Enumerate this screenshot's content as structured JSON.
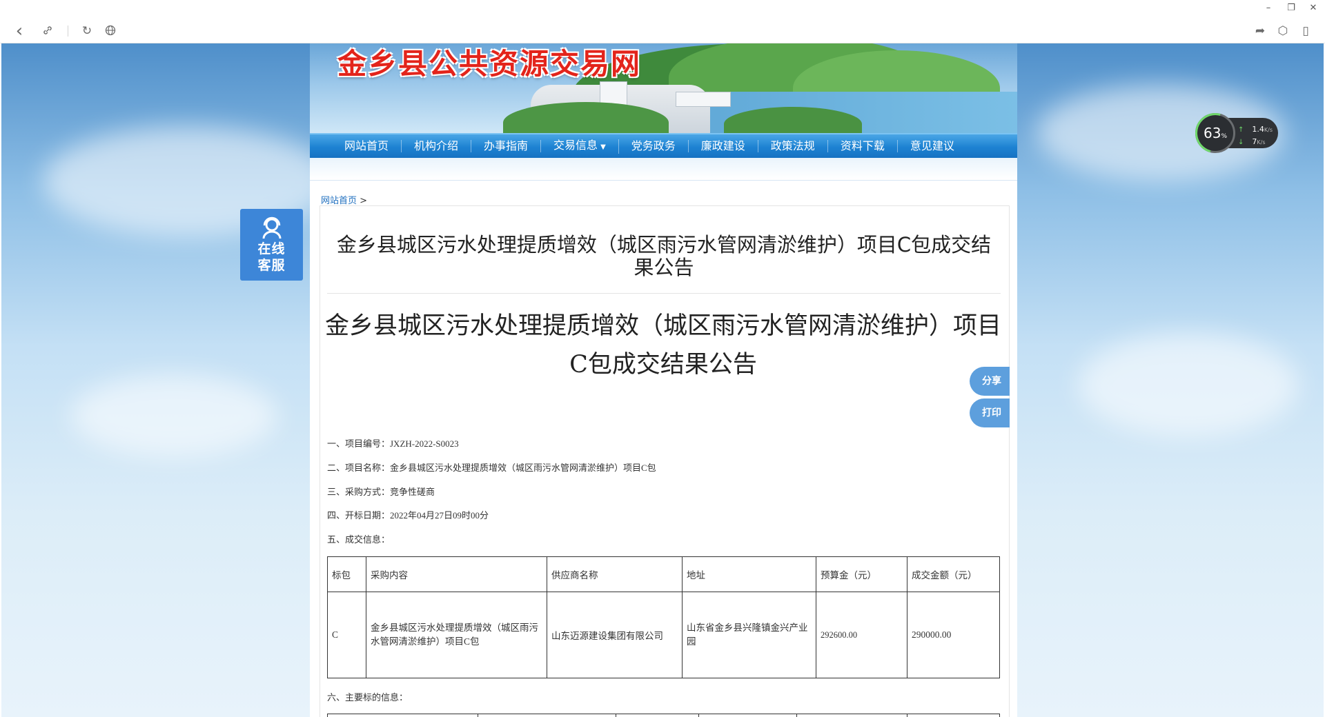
{
  "window": {
    "minimize": "–",
    "restore": "❐",
    "close": "✕"
  },
  "toolbar": {
    "back": "‹",
    "link": "🔗",
    "reload": "↻",
    "globe": "🌐",
    "share": "➦",
    "box": "⬡",
    "phone": "▯"
  },
  "site": {
    "title": "金乡县公共资源交易网"
  },
  "nav": {
    "items": [
      {
        "label": "网站首页"
      },
      {
        "label": "机构介绍"
      },
      {
        "label": "办事指南"
      },
      {
        "label": "交易信息",
        "caret": "▼"
      },
      {
        "label": "党务政务"
      },
      {
        "label": "廉政建设"
      },
      {
        "label": "政策法规"
      },
      {
        "label": "资料下载"
      },
      {
        "label": "意见建议"
      }
    ]
  },
  "breadcrumb": {
    "home": "网站首页",
    "sep": ">"
  },
  "article": {
    "title_sans": "金乡县城区污水处理提质增效（城区雨污水管网清淤维护）项目C包成交结果公告",
    "title_serif": "金乡县城区污水处理提质增效（城区雨污水管网清淤维护）项目C包成交结果公告",
    "info": [
      "一、项目编号：JXZH-2022-S0023",
      "二、项目名称：金乡县城区污水处理提质增效（城区雨污水管网清淤维护）项目C包",
      "三、采购方式：竞争性磋商",
      "四、开标日期：2022年04月27日09时00分",
      "五、成交信息："
    ],
    "deal_table": {
      "headers": [
        "标包",
        "采购内容",
        "供应商名称",
        "地址",
        "预算金（元）",
        "成交金额（元）"
      ],
      "row": [
        "C",
        "金乡县城区污水处理提质增效（城区雨污水管网清淤维护）项目C包",
        "山东迈源建设集团有限公司",
        "山东省金乡县兴隆镇金兴产业园",
        "292600.00",
        "290000.00"
      ]
    },
    "section6": "六、主要标的信息："
  },
  "kefu": {
    "line1": "在线",
    "line2": "客服"
  },
  "side": {
    "share": "分享",
    "print": "打印"
  },
  "speed": {
    "percent": "63",
    "percent_unit": "%",
    "up": "1.4",
    "up_unit": "K/s",
    "down": "7",
    "down_unit": "K/s"
  }
}
